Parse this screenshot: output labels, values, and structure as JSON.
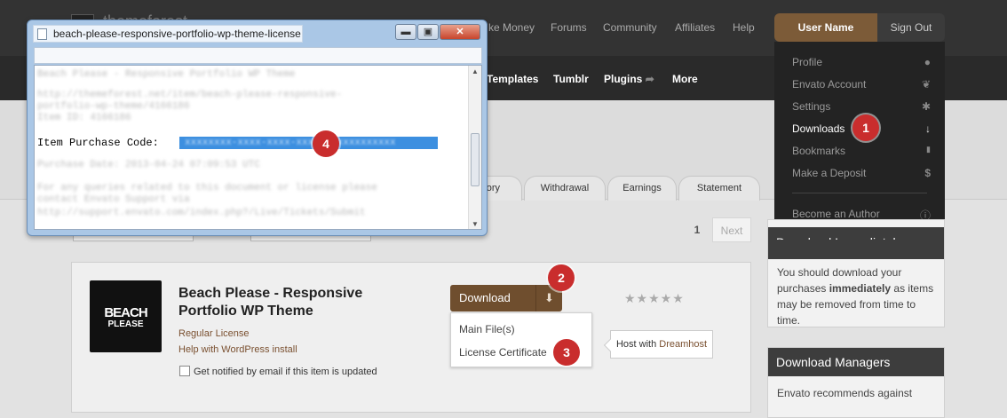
{
  "topnav": {
    "logo_text": "themeforest",
    "links": [
      "ke Money",
      "Forums",
      "Community",
      "Affiliates",
      "Help"
    ]
  },
  "subnav": {
    "links": [
      "Templates",
      "Tumblr",
      "Plugins",
      "More"
    ]
  },
  "user": {
    "name": "User Name",
    "signout": "Sign Out"
  },
  "user_menu": {
    "items": [
      {
        "label": "Profile",
        "icon": "user-icon",
        "glyph": "●"
      },
      {
        "label": "Envato Account",
        "icon": "leaf-icon",
        "glyph": "❦"
      },
      {
        "label": "Settings",
        "icon": "gear-icon",
        "glyph": "✱"
      },
      {
        "label": "Downloads",
        "icon": "download-arrow-icon",
        "glyph": "↓"
      },
      {
        "label": "Bookmarks",
        "icon": "bookmark-icon",
        "glyph": "▮"
      },
      {
        "label": "Make a Deposit",
        "icon": "dollar-icon",
        "glyph": "$"
      }
    ],
    "become_author": {
      "label": "Become an Author",
      "icon": "info-icon",
      "glyph": "ⓘ"
    }
  },
  "tabs": [
    "ory",
    "Withdrawal",
    "Earnings",
    "Statement"
  ],
  "pagination": {
    "current": "1",
    "next": "Next"
  },
  "item": {
    "title": "Beach Please - Responsive Portfolio WP Theme",
    "thumb_line1": "BEACH",
    "thumb_line2": "PLEASE",
    "license": "Regular License",
    "help_link": "Help with WordPress install",
    "notify": "Get notified by email if this item is updated",
    "download_label": "Download",
    "download_options": [
      "Main File(s)",
      "License Certificate"
    ],
    "stars": "★★★★★",
    "host_prefix": "Host with ",
    "host_link": "Dreamhost"
  },
  "sidebar": {
    "box1": {
      "title": "Download Immediately",
      "body_pre": "You should download your purchases ",
      "body_bold": "immediately",
      "body_post": " as items may be removed from time to time."
    },
    "box2": {
      "title": "Download Managers",
      "body": "Envato recommends against"
    }
  },
  "license_window": {
    "title": "beach-please-responsive-portfolio-wp-theme-license",
    "blurred_lines": [
      "Beach Please - Responsive Portfolio WP Theme",
      "http://themeforest.net/item/beach-please-responsive-",
      "portfolio-wp-theme/4166186",
      "Item ID: 4166186",
      "Purchase Date: 2013-04-24 07:09:53 UTC",
      "For any queries related to this document or license please",
      "contact Envato Support via",
      "http://support.envato.com/index.php?/Live/Tickets/Submit"
    ],
    "purchase_code_label": "Item Purchase Code:",
    "purchase_code_blurred": "xxxxxxxx-xxxx-xxxx-xxxx-xxxxxxxxxxxx"
  },
  "badges": [
    "1",
    "2",
    "3",
    "4"
  ],
  "colors": {
    "accent_brown": "#7c5b38",
    "badge_red": "#c92d2d",
    "selection_blue": "#3c8fe0"
  }
}
